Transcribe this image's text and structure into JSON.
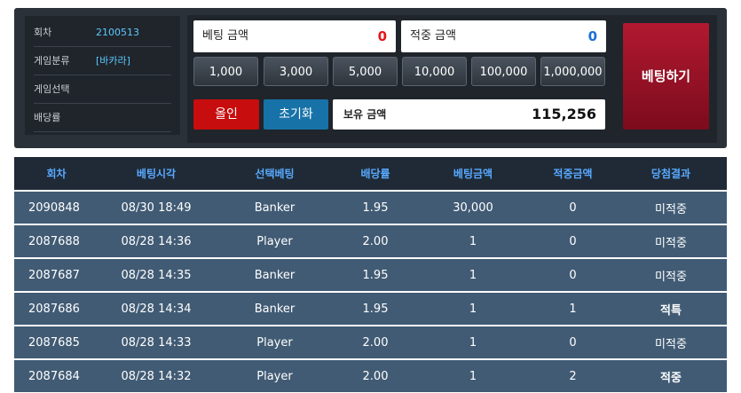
{
  "info": {
    "round_label": "회차",
    "round_value": "2100513",
    "category_label": "게임분류",
    "category_value": "[바카라]",
    "select_label": "게임선택",
    "odds_label": "배당률"
  },
  "bet": {
    "bet_amount_label": "베팅 금액",
    "bet_amount_value": "0",
    "payout_label": "적중 금액",
    "payout_value": "0",
    "chips": [
      "1,000",
      "3,000",
      "5,000",
      "10,000",
      "100,000",
      "1,000,000"
    ],
    "allin_label": "올인",
    "reset_label": "초기화",
    "holding_label": "보유 금액",
    "holding_value": "115,256",
    "bet_button_label": "베팅하기"
  },
  "colors": {
    "bet_amount": "#e4161b",
    "payout": "#1a6fd6",
    "lose": "#e82020",
    "win": "#f3b21a"
  },
  "history": {
    "headers": [
      "회차",
      "베팅시각",
      "선택베팅",
      "배당률",
      "베팅금액",
      "적중금액",
      "당첨결과"
    ],
    "rows": [
      {
        "round": "2090848",
        "time": "08/30 18:49",
        "pick": "Banker",
        "odds": "1.95",
        "bet": "30,000",
        "won": "0",
        "result": "미적중",
        "status": "lose"
      },
      {
        "round": "2087688",
        "time": "08/28 14:36",
        "pick": "Player",
        "odds": "2.00",
        "bet": "1",
        "won": "0",
        "result": "미적중",
        "status": "lose"
      },
      {
        "round": "2087687",
        "time": "08/28 14:35",
        "pick": "Banker",
        "odds": "1.95",
        "bet": "1",
        "won": "0",
        "result": "미적중",
        "status": "lose"
      },
      {
        "round": "2087686",
        "time": "08/28 14:34",
        "pick": "Banker",
        "odds": "1.95",
        "bet": "1",
        "won": "1",
        "result": "적특",
        "status": "win"
      },
      {
        "round": "2087685",
        "time": "08/28 14:33",
        "pick": "Player",
        "odds": "2.00",
        "bet": "1",
        "won": "0",
        "result": "미적중",
        "status": "lose"
      },
      {
        "round": "2087684",
        "time": "08/28 14:32",
        "pick": "Player",
        "odds": "2.00",
        "bet": "1",
        "won": "2",
        "result": "적중",
        "status": "win"
      }
    ]
  }
}
